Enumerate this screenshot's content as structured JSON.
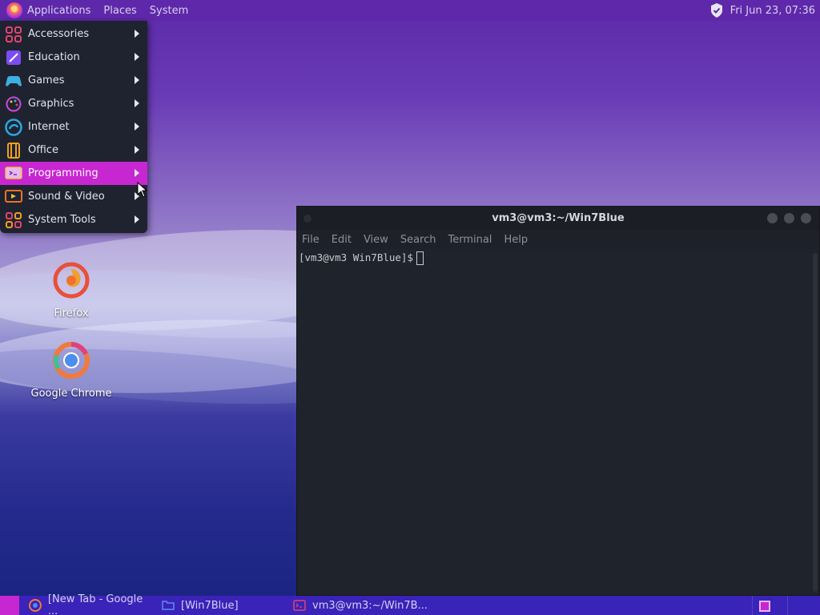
{
  "top_panel": {
    "menus": [
      {
        "label": "Applications"
      },
      {
        "label": "Places"
      },
      {
        "label": "System"
      }
    ],
    "clock": "Fri Jun 23, 07:36",
    "tray_icon": "shield-check-icon"
  },
  "apps_menu": {
    "items": [
      {
        "label": "Accessories",
        "icon": "accessories-icon",
        "color": "#e04470"
      },
      {
        "label": "Education",
        "icon": "education-icon",
        "color": "#7b4cf0"
      },
      {
        "label": "Games",
        "icon": "games-icon",
        "color": "#3cb0e0"
      },
      {
        "label": "Graphics",
        "icon": "graphics-icon",
        "color": "#c84ad8"
      },
      {
        "label": "Internet",
        "icon": "internet-icon",
        "color": "#2aa8e0"
      },
      {
        "label": "Office",
        "icon": "office-icon",
        "color": "#f0a020"
      },
      {
        "label": "Programming",
        "icon": "programming-icon",
        "color": "#f0c040",
        "active": true
      },
      {
        "label": "Sound & Video",
        "icon": "sound-video-icon",
        "color": "#f07020"
      },
      {
        "label": "System Tools",
        "icon": "system-tools-icon",
        "color": "#e04470"
      }
    ],
    "active_color": "#c727d0"
  },
  "desktop_icons": [
    {
      "label": "Firefox",
      "icon": "firefox-icon"
    },
    {
      "label": "Google Chrome",
      "icon": "chrome-icon"
    }
  ],
  "terminal": {
    "title": "vm3@vm3:~/Win7Blue",
    "menu": [
      "File",
      "Edit",
      "View",
      "Search",
      "Terminal",
      "Help"
    ],
    "prompt": "[vm3@vm3 Win7Blue]$"
  },
  "taskbar": {
    "tasks": [
      {
        "label": "[New Tab - Google ...",
        "icon": "chrome-icon"
      },
      {
        "label": "[Win7Blue]",
        "icon": "folder-icon"
      },
      {
        "label": "vm3@vm3:~/Win7B...",
        "icon": "terminal-icon"
      }
    ],
    "color": "#3a23b8"
  }
}
